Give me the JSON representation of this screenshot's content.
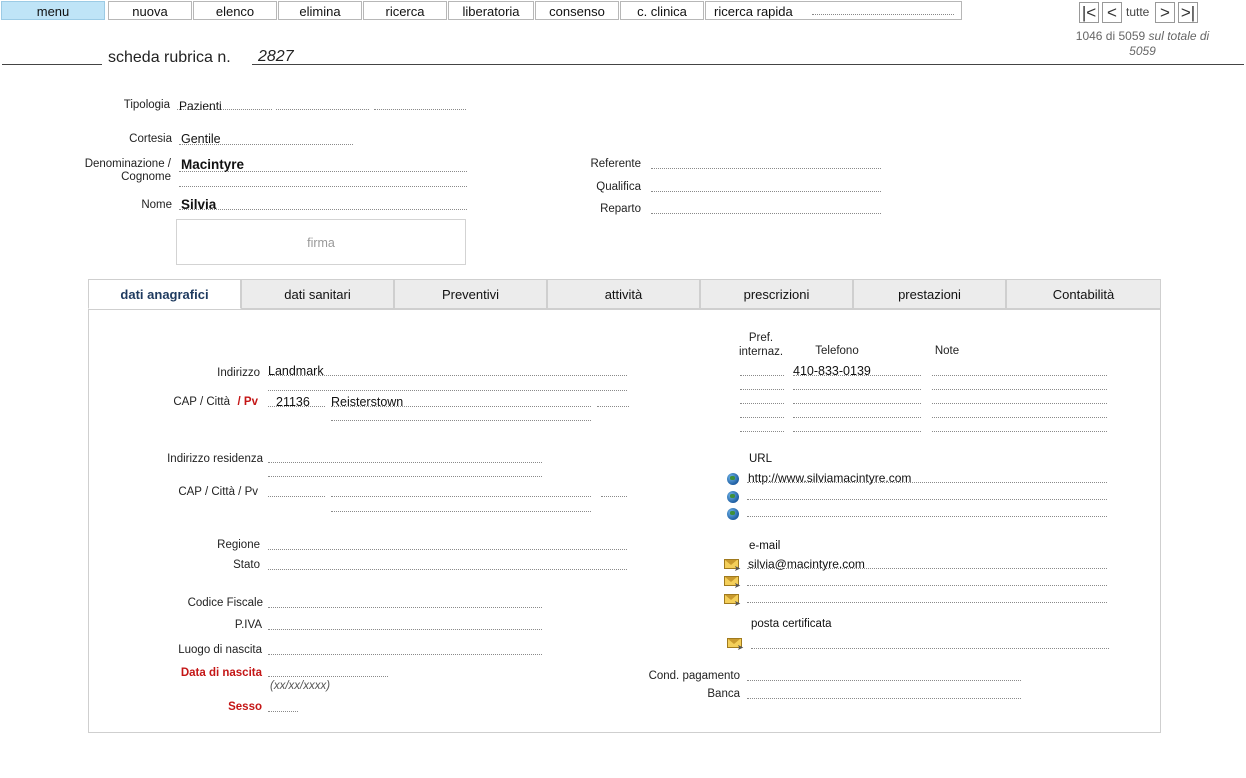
{
  "menu": {
    "items": [
      "menu",
      "nuova",
      "elenco",
      "elimina",
      "ricerca",
      "liberatoria",
      "consenso",
      "c. clinica",
      "ricerca rapida"
    ]
  },
  "nav": {
    "first": "|<",
    "prev": "<",
    "all": "tutte",
    "next": ">",
    "last": ">|",
    "counter": "1046 di 5059",
    "total_label": "sul totale di",
    "total": "5059"
  },
  "record": {
    "title": "scheda rubrica n.",
    "number": "2827"
  },
  "header_fields": {
    "tipologia_label": "Tipologia",
    "tipologia": "Pazienti",
    "cortesia_label": "Cortesia",
    "cortesia": "Gentile",
    "denominazione_label_1": "Denominazione /",
    "denominazione_label_2": "Cognome",
    "cognome": "Macintyre",
    "nome_label": "Nome",
    "nome": "Silvia",
    "firma": "firma",
    "referente_label": "Referente",
    "qualifica_label": "Qualifica",
    "reparto_label": "Reparto"
  },
  "tabs": [
    "dati anagrafici",
    "dati sanitari",
    "Preventivi",
    "attività",
    "prescrizioni",
    "prestazioni",
    "Contabilità"
  ],
  "anagrafici": {
    "indirizzo_label": "Indirizzo",
    "indirizzo": "Landmark",
    "cap_label": "CAP  / Città",
    "pv_label": "/  Pv",
    "cap": "21136",
    "citta": "Reisterstown",
    "indirizzo_res_label": "Indirizzo residenza",
    "cap_res_label": "CAP / Città / Pv",
    "regione_label": "Regione",
    "stato_label": "Stato",
    "cf_label": "Codice Fiscale",
    "piva_label": "P.IVA",
    "luogo_label": "Luogo di nascita",
    "data_label": "Data di nascita",
    "data_hint": "(xx/xx/xxxx)",
    "sesso_label": "Sesso"
  },
  "contacts": {
    "pref_label_1": "Pref.",
    "pref_label_2": "internaz.",
    "tel_label": "Telefono",
    "note_label": "Note",
    "telefono": "410-833-0139",
    "url_label": "URL",
    "url": "http://www.silviamacintyre.com",
    "email_label": "e-mail",
    "email": "silvia@macintyre.com",
    "pec_label": "posta certificata",
    "cond_label": "Cond. pagamento",
    "banca_label": "Banca",
    "icons": {
      "url": "globe-icon",
      "email": "envelope-icon"
    }
  },
  "colors": {
    "active_menu": "#bfe4f7",
    "required_label": "#c41616",
    "active_tab_text": "#1e3a5f"
  }
}
